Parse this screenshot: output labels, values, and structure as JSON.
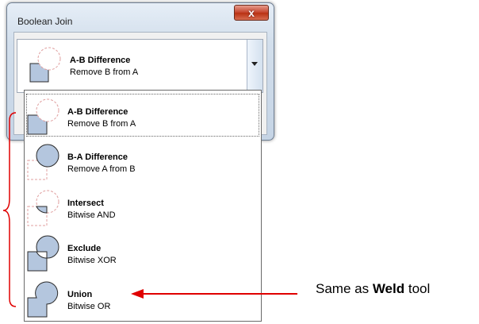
{
  "window": {
    "title": "Boolean Join",
    "close_glyph": "x"
  },
  "combo": {
    "selected_title": "A-B Difference",
    "selected_subtitle": "Remove B from A",
    "icon": "ab-difference-icon"
  },
  "dropdown": {
    "items": [
      {
        "title": "A-B Difference",
        "subtitle": "Remove B from A",
        "icon": "ab-difference-icon",
        "selected": true
      },
      {
        "title": "B-A Difference",
        "subtitle": "Remove A from B",
        "icon": "ba-difference-icon",
        "selected": false
      },
      {
        "title": "Intersect",
        "subtitle": "Bitwise AND",
        "icon": "intersect-icon",
        "selected": false
      },
      {
        "title": "Exclude",
        "subtitle": "Bitwise XOR",
        "icon": "exclude-icon",
        "selected": false
      },
      {
        "title": "Union",
        "subtitle": "Bitwise OR",
        "icon": "union-icon",
        "selected": false
      }
    ]
  },
  "annotation": {
    "prefix": "Same as ",
    "bold": "Weld",
    "suffix": " tool",
    "color": "#e00000"
  },
  "colors": {
    "shape_fill": "#b4c6de",
    "shape_stroke": "#2b2b2b",
    "dashed_stroke": "#e0a0a0"
  }
}
